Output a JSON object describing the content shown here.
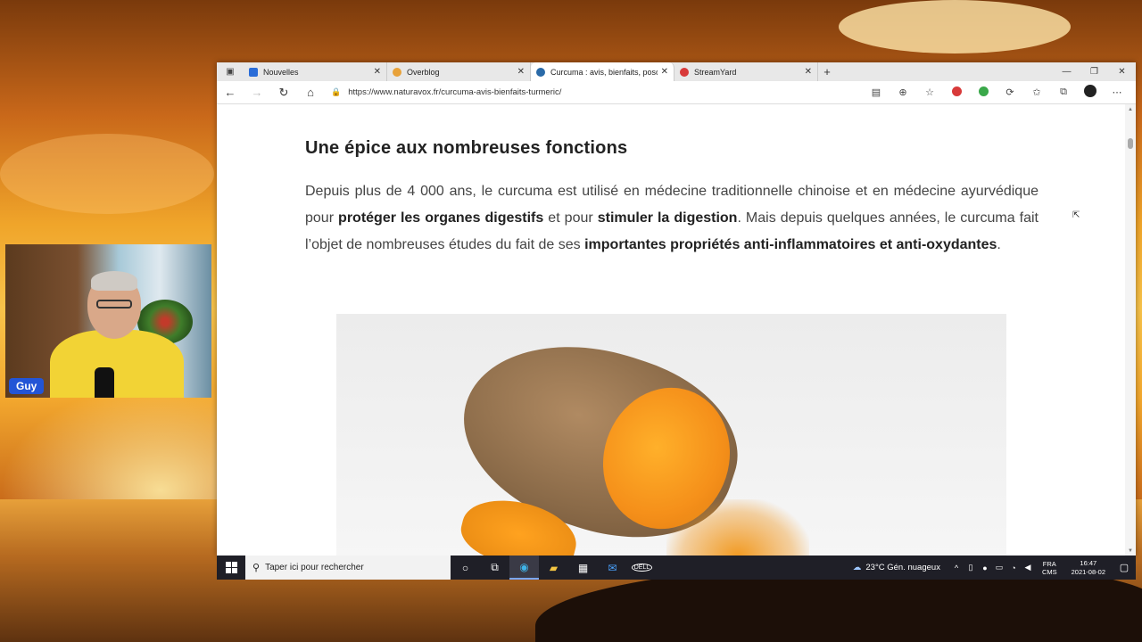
{
  "tabs": [
    {
      "label": "Nouvelles",
      "color": "#2a6dd8"
    },
    {
      "label": "Overblog",
      "color": "#e8a23a"
    },
    {
      "label": "Curcuma : avis, bienfaits, posolo",
      "color": "#2a6aa8",
      "active": true
    },
    {
      "label": "StreamYard",
      "color": "#d83a3a"
    }
  ],
  "address": {
    "url": "https://www.naturavox.fr/curcuma-avis-bienfaits-turmeric/"
  },
  "article": {
    "heading": "Une épice aux nombreuses fonctions",
    "p1": "Depuis plus de 4 000 ans, le curcuma est utilisé en médecine traditionnelle chinoise et en médecine ayurvédique pour ",
    "b1": "protéger les organes digestifs",
    "p2": " et pour ",
    "b2": "stimuler la digestion",
    "p3": ". Mais depuis quelques années, le curcuma fait l’objet de nombreuses études du fait de ses ",
    "b3": "importantes propriétés anti-inflammatoires et anti-oxydantes",
    "p4": "."
  },
  "webcam": {
    "name": "Guy"
  },
  "taskbar": {
    "search_placeholder": "Taper ici pour rechercher",
    "weather": "23°C  Gén. nuageux",
    "lang_line1": "FRA",
    "lang_line2": "CMS",
    "time": "16:47",
    "date": "2021-08-02"
  },
  "icons": {
    "back": "back-arrow-icon",
    "forward": "forward-arrow-icon",
    "refresh": "refresh-icon",
    "home": "home-icon"
  }
}
